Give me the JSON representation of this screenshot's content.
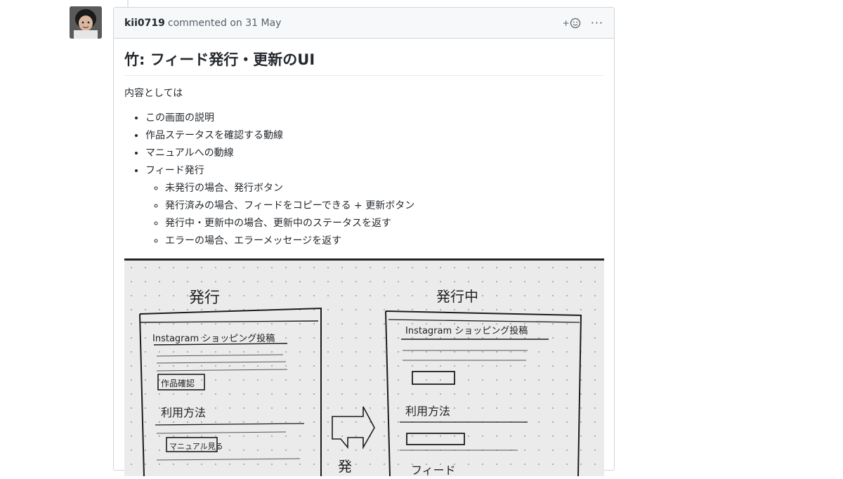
{
  "comment": {
    "author": "kii0719",
    "meta_text": "commented on 31 May",
    "reaction_plus": "+",
    "more_label": "···"
  },
  "body": {
    "title": "竹: フィード発行・更新のUI",
    "lead": "内容としては",
    "items": [
      "この画面の説明",
      "作品ステータスを確認する動線",
      "マニュアルへの動線",
      "フィード発行"
    ],
    "subitems": [
      "未発行の場合、発行ボタン",
      "発行済みの場合、フィードをコピーできる + 更新ボタン",
      "発行中・更新中の場合、更新中のステータスを返す",
      "エラーの場合、エラーメッセージを返す"
    ]
  },
  "sketch": {
    "left_heading": "発行",
    "right_heading": "発行中",
    "left_app_title": "Instagram ショッピング投稿",
    "right_app_title": "Instagram ショッピング投稿",
    "left_check_button": "作品確認",
    "left_usage": "利用方法",
    "right_usage": "利用方法",
    "left_manual_button": "マニュアル見る",
    "arrow_label": "発",
    "right_feed_label": "フィード"
  }
}
